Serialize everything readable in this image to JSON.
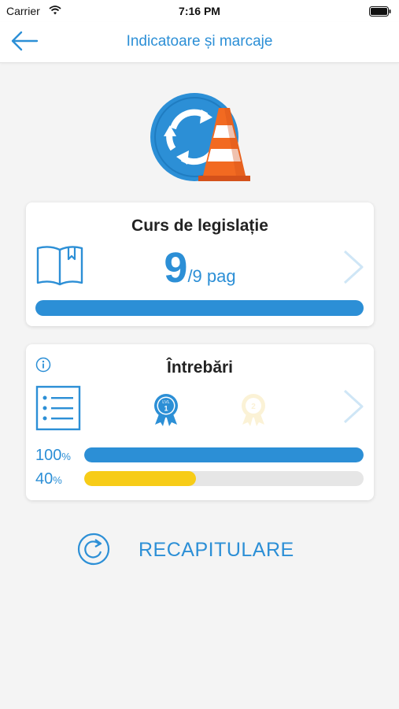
{
  "status_bar": {
    "carrier": "Carrier",
    "time": "7:16 PM"
  },
  "nav": {
    "title": "Indicatoare și marcaje",
    "back_icon": "arrow-left-icon"
  },
  "hero": {
    "icon": "roundabout-traffic-cone-icon"
  },
  "legislation": {
    "title": "Curs de legislație",
    "pages_read": "9",
    "pages_total": "/9 pag",
    "progress": 1.0
  },
  "questions": {
    "title": "Întrebări",
    "levels": [
      {
        "badge": "LVL",
        "number": "1",
        "unlocked": true
      },
      {
        "badge": "",
        "number": "2",
        "unlocked": false
      }
    ],
    "bars": [
      {
        "value": "100",
        "unit": "%",
        "fraction": 1.0,
        "color": "#2c8fd6"
      },
      {
        "value": "40",
        "unit": "%",
        "fraction": 0.4,
        "color": "#f7cc17"
      }
    ]
  },
  "recap": {
    "label": "RECAPITULARE"
  },
  "colors": {
    "accent": "#2c8fd6",
    "yellow": "#f7cc17",
    "cone": "#f26a21"
  }
}
